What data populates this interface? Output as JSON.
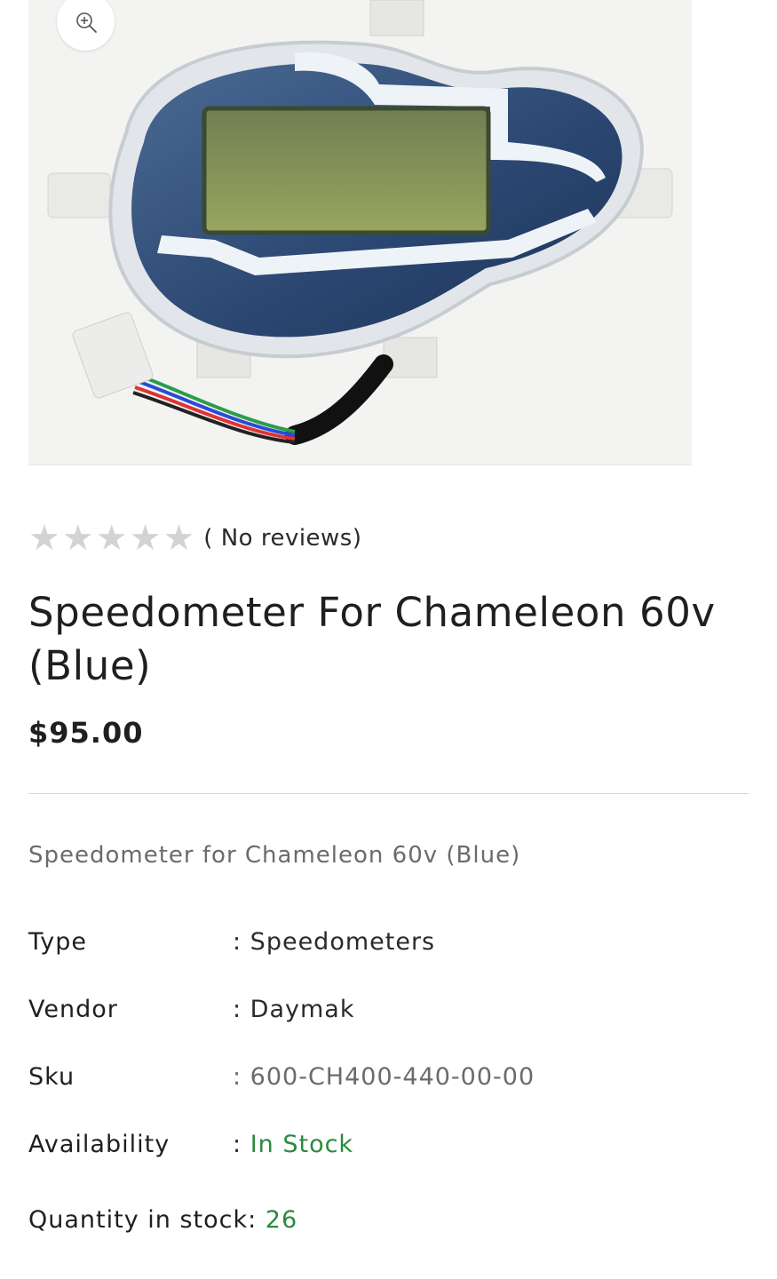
{
  "product": {
    "image_alt": "Speedometer For Chameleon 60v (Blue)",
    "zoom_icon": "zoom-in-icon",
    "rating": {
      "stars_filled": 0,
      "stars_total": 5,
      "reviews_text": "( No reviews)"
    },
    "title": "Speedometer For Chameleon 60v (Blue)",
    "price": "$95.00",
    "description": "Speedometer for Chameleon 60v (Blue)",
    "specs": {
      "type_label": "Type",
      "type_value": ": Speedometers",
      "vendor_label": "Vendor",
      "vendor_value": ": Daymak",
      "sku_label": "Sku",
      "sku_value": ": 600-CH400-440-00-00",
      "availability_label": "Availability",
      "availability_sep": ": ",
      "availability_value": "In Stock"
    },
    "quantity_label": "Quantity in stock: ",
    "quantity_value": "26"
  },
  "colors": {
    "in_stock": "#2b8a3e",
    "star_empty": "#d3d3d3",
    "meter_lcd": "#8f9a5e",
    "meter_body": "#2f4f7a"
  }
}
